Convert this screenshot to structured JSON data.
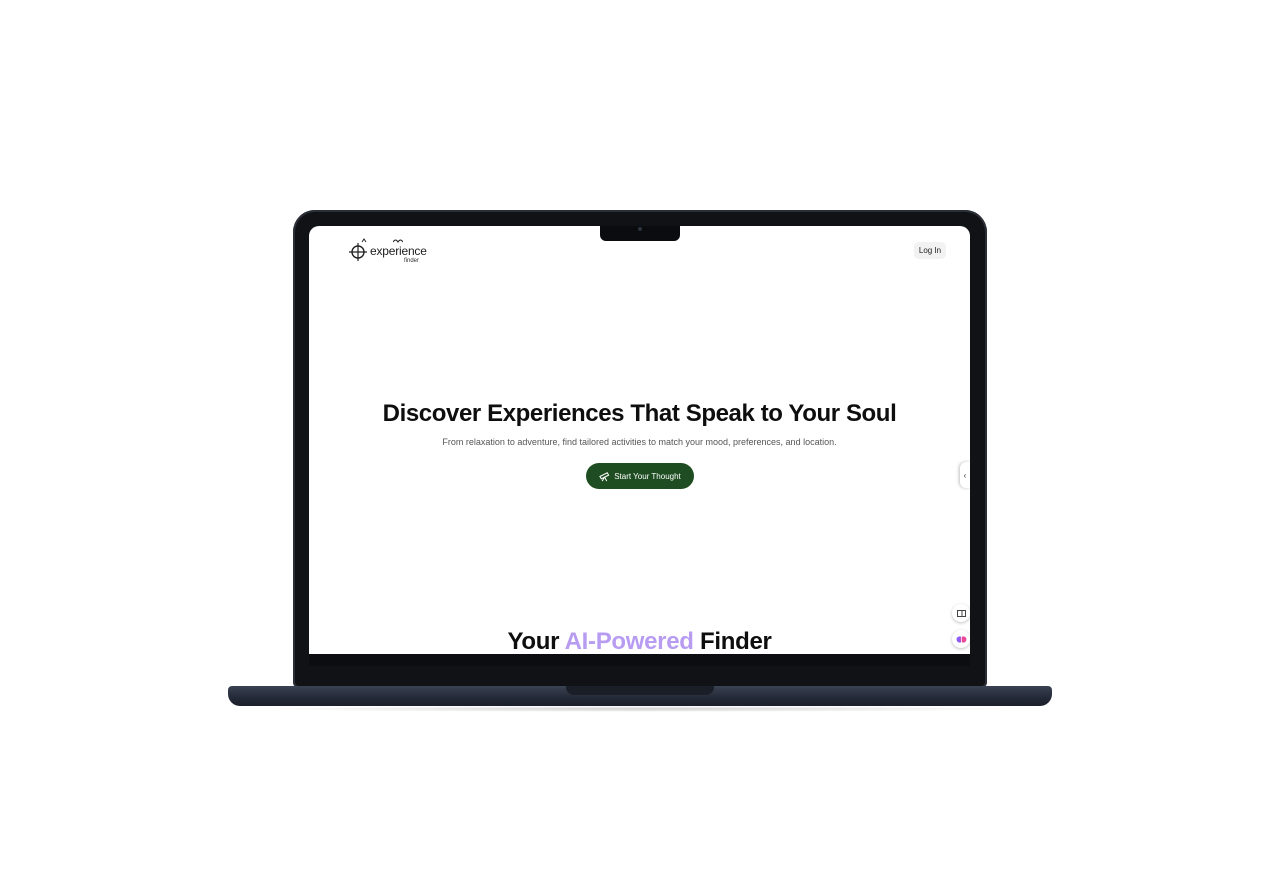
{
  "header": {
    "logo_word": "experience",
    "logo_sub": "finder",
    "login_label": "Log In"
  },
  "hero": {
    "title": "Discover Experiences That Speak to Your Soul",
    "subtitle": "From relaxation to adventure, find tailored activities to match your mood, preferences, and location.",
    "cta_label": "Start Your Thought",
    "cta_icon": "telescope-icon",
    "cta_color": "#1f4d22"
  },
  "section": {
    "title_before": "Your ",
    "title_accent": "AI-Powered",
    "title_after": " Finder",
    "accent_color": "#b79cf2"
  },
  "side_tab": {
    "icon": "chevron-icon",
    "glyph": "‹"
  },
  "floating_buttons": [
    {
      "icon": "panel-toggle-icon"
    },
    {
      "icon": "brain-icon"
    }
  ]
}
